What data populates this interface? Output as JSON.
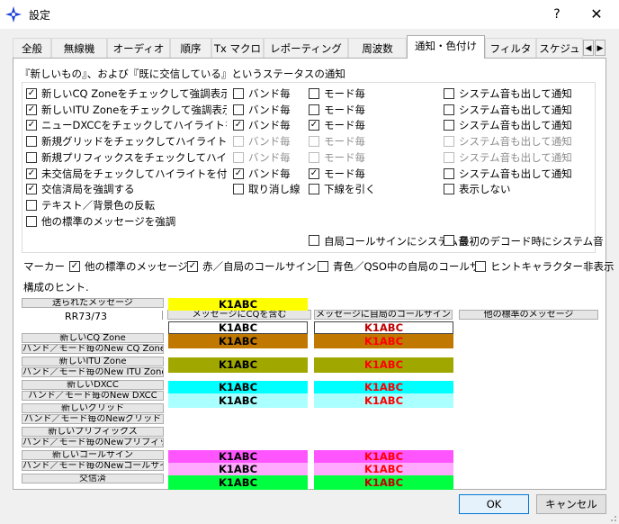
{
  "window": {
    "title": "設定",
    "help": "?",
    "close": "✕"
  },
  "tabs": [
    "全般",
    "無線機",
    "オーディオ",
    "順序",
    "Tx マクロ",
    "レポーティング",
    "周波数",
    "通知・色付け",
    "フィルタ",
    "スケジュ"
  ],
  "active_tab": "通知・色付け",
  "section_title": "『新しいもの』、および『既に交信している』というステータスの通知",
  "rows": [
    {
      "label": "新しいCQ Zoneをチェックして強調表示する",
      "checked": true,
      "band": {
        "label": "バンド毎",
        "checked": false,
        "enabled": true
      },
      "mode": {
        "label": "モード毎",
        "checked": false,
        "enabled": true
      },
      "sound": {
        "label": "システム音も出して通知",
        "checked": false,
        "enabled": true
      }
    },
    {
      "label": "新しいITU Zoneをチェックして強調表示する",
      "checked": true,
      "band": {
        "label": "バンド毎",
        "checked": false,
        "enabled": true
      },
      "mode": {
        "label": "モード毎",
        "checked": false,
        "enabled": true
      },
      "sound": {
        "label": "システム音も出して通知",
        "checked": false,
        "enabled": true
      }
    },
    {
      "label": "ニューDXCCをチェックしてハイライトを付ける",
      "checked": true,
      "band": {
        "label": "バンド毎",
        "checked": true,
        "enabled": true
      },
      "mode": {
        "label": "モード毎",
        "checked": true,
        "enabled": true
      },
      "sound": {
        "label": "システム音も出して通知",
        "checked": false,
        "enabled": true
      }
    },
    {
      "label": "新規グリッドをチェックしてハイライトを付ける",
      "checked": false,
      "band": {
        "label": "バンド毎",
        "checked": false,
        "enabled": false
      },
      "mode": {
        "label": "モード毎",
        "checked": false,
        "enabled": false
      },
      "sound": {
        "label": "システム音も出して通知",
        "checked": false,
        "enabled": false
      }
    },
    {
      "label": "新規プリフィックスをチェックしてハイライトを付け",
      "checked": false,
      "band": {
        "label": "バンド毎",
        "checked": false,
        "enabled": false
      },
      "mode": {
        "label": "モード毎",
        "checked": false,
        "enabled": false
      },
      "sound": {
        "label": "システム音も出して通知",
        "checked": false,
        "enabled": false
      }
    },
    {
      "label": "未交信局をチェックしてハイライトを付ける",
      "checked": true,
      "band": {
        "label": "バンド毎",
        "checked": true,
        "enabled": true
      },
      "mode": {
        "label": "モード毎",
        "checked": true,
        "enabled": true
      },
      "sound": {
        "label": "システム音も出して通知",
        "checked": false,
        "enabled": true
      }
    },
    {
      "label": "交信済局を強調する",
      "checked": true,
      "band": {
        "label": "取り消し線",
        "checked": false,
        "enabled": true
      },
      "mode": {
        "label": "下線を引く",
        "checked": false,
        "enabled": true
      },
      "sound": {
        "label": "表示しない",
        "checked": false,
        "enabled": true
      }
    },
    {
      "label": "テキスト／背景色の反転",
      "checked": false
    },
    {
      "label": "他の標準のメッセージを強調",
      "checked": false
    }
  ],
  "extra": {
    "own_call_sound": {
      "label": "自局コールサインにシステム音",
      "checked": false
    },
    "first_decode_sound": {
      "label": "最初のデコード時にシステム音",
      "checked": false
    }
  },
  "marker": {
    "label": "マーカー",
    "items": [
      {
        "label": "他の標準のメッセージ",
        "checked": true
      },
      {
        "label": "赤／自局のコールサイン",
        "checked": true
      },
      {
        "label": "青色／QSO中の自局のコールサ",
        "checked": false
      },
      {
        "label": "ヒントキャラクター非表示",
        "checked": false
      }
    ]
  },
  "hint_title": "構成のヒント.",
  "color_buttons": [
    "送られたメッセージ",
    "新しいCQ Zone",
    "バンド／モード毎のNew CQ Zone",
    "新しいITU Zone",
    "バンド／モード毎のNew ITU Zone",
    "新しいDXCC",
    "バンド／モード毎のNew DXCC",
    "新しいグリッド",
    "バンド／モード毎のNewグリッド",
    "新しいプリフィックス",
    "バンド／モード毎のNewプリフィックス",
    "新しいコールサイン",
    "バンド／モード毎のNewコールサイン",
    "交信済"
  ],
  "rr73": "RR73/73",
  "col_buttons": [
    "メッセージにCQを含む",
    "メッセージに自局のコールサイン",
    "他の標準のメッセージ"
  ],
  "sample_call": "K1ABC",
  "colors": {
    "yellow": "#ffff00",
    "white": "#ffffff",
    "brown": "#c07800",
    "olive": "#a0a800",
    "cyan": "#00ffff",
    "light_cyan": "#aaffff",
    "magenta": "#ff55ff",
    "light_magenta": "#ffaaff",
    "green": "#00ff40",
    "red_text": "#ff0000",
    "dark_red_text": "#c00000",
    "accent": "#0078d7"
  },
  "buttons": {
    "ok": "OK",
    "cancel": "キャンセル"
  }
}
